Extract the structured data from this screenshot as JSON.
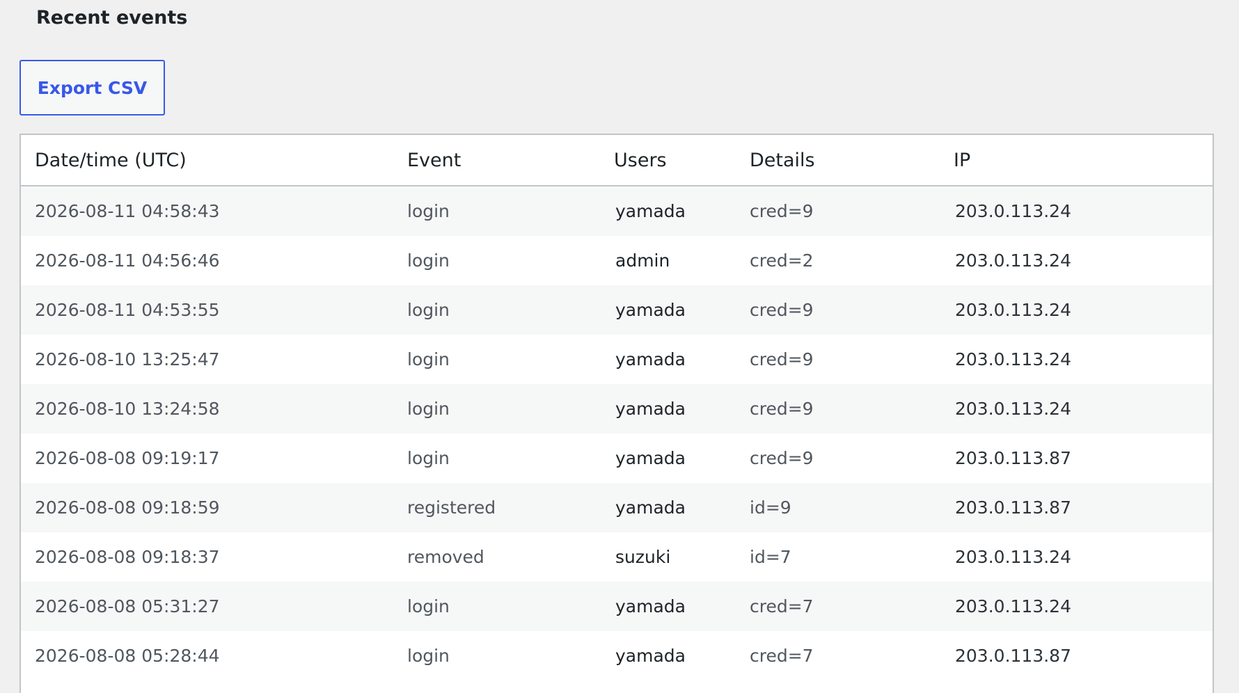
{
  "section": {
    "title": "Recent events"
  },
  "toolbar": {
    "export_label": "Export CSV"
  },
  "table": {
    "headers": {
      "date": "Date/time (UTC)",
      "event": "Event",
      "users": "Users",
      "details": "Details",
      "ip": "IP"
    },
    "rows": [
      {
        "date": "2026-08-11 04:58:43",
        "event": "login",
        "users": "yamada",
        "details": "cred=9",
        "ip": "203.0.113.24"
      },
      {
        "date": "2026-08-11 04:56:46",
        "event": "login",
        "users": "admin",
        "details": "cred=2",
        "ip": "203.0.113.24"
      },
      {
        "date": "2026-08-11 04:53:55",
        "event": "login",
        "users": "yamada",
        "details": "cred=9",
        "ip": "203.0.113.24"
      },
      {
        "date": "2026-08-10 13:25:47",
        "event": "login",
        "users": "yamada",
        "details": "cred=9",
        "ip": "203.0.113.24"
      },
      {
        "date": "2026-08-10 13:24:58",
        "event": "login",
        "users": "yamada",
        "details": "cred=9",
        "ip": "203.0.113.24"
      },
      {
        "date": "2026-08-08 09:19:17",
        "event": "login",
        "users": "yamada",
        "details": "cred=9",
        "ip": "203.0.113.87"
      },
      {
        "date": "2026-08-08 09:18:59",
        "event": "registered",
        "users": "yamada",
        "details": "id=9",
        "ip": "203.0.113.87"
      },
      {
        "date": "2026-08-08 09:18:37",
        "event": "removed",
        "users": "suzuki",
        "details": "id=7",
        "ip": "203.0.113.24"
      },
      {
        "date": "2026-08-08 05:31:27",
        "event": "login",
        "users": "yamada",
        "details": "cred=7",
        "ip": "203.0.113.24"
      },
      {
        "date": "2026-08-08 05:28:44",
        "event": "login",
        "users": "yamada",
        "details": "cred=7",
        "ip": "203.0.113.87"
      }
    ]
  },
  "colors": {
    "background": "#f0f0f1",
    "accent": "#3858e9",
    "border": "#c3c4c7",
    "row_alt": "#f6f7f7"
  }
}
